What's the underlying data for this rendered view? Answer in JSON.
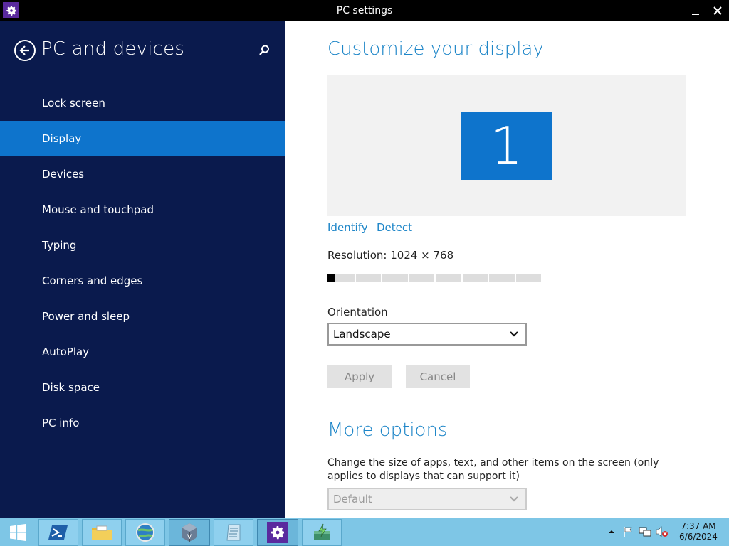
{
  "window": {
    "title": "PC settings",
    "minimize_label": "–",
    "close_label": "✕"
  },
  "left_pane": {
    "title": "PC and devices",
    "nav_items": [
      {
        "label": "Lock screen"
      },
      {
        "label": "Display",
        "selected": true
      },
      {
        "label": "Devices"
      },
      {
        "label": "Mouse and touchpad"
      },
      {
        "label": "Typing"
      },
      {
        "label": "Corners and edges"
      },
      {
        "label": "Power and sleep"
      },
      {
        "label": "AutoPlay"
      },
      {
        "label": "Disk space"
      },
      {
        "label": "PC info"
      }
    ]
  },
  "display": {
    "heading": "Customize your display",
    "monitor_number": "1",
    "identify_label": "Identify",
    "detect_label": "Detect",
    "resolution_label": "Resolution: 1024 × 768",
    "resolution_slider": {
      "steps": 8,
      "position": 0
    },
    "orientation_label": "Orientation",
    "orientation_value": "Landscape",
    "apply_label": "Apply",
    "cancel_label": "Cancel"
  },
  "more_options": {
    "heading": "More options",
    "description": "Change the size of apps, text, and other items on the screen (only applies to displays that can support it)",
    "size_value": "Default"
  },
  "taskbar": {
    "clock_time": "7:37 AM",
    "clock_date": "6/6/2024",
    "items": [
      "start-icon",
      "powershell-icon",
      "file-explorer-icon",
      "network-globe-icon",
      "virtualbox-icon",
      "notepad-icon",
      "pc-settings-icon",
      "flash-drive-icon"
    ]
  },
  "colors": {
    "accent": "#0e74cc",
    "left_pane_bg": "#0a1a4d",
    "heading": "#1e86c8",
    "taskbar": "#7ec6e6"
  }
}
